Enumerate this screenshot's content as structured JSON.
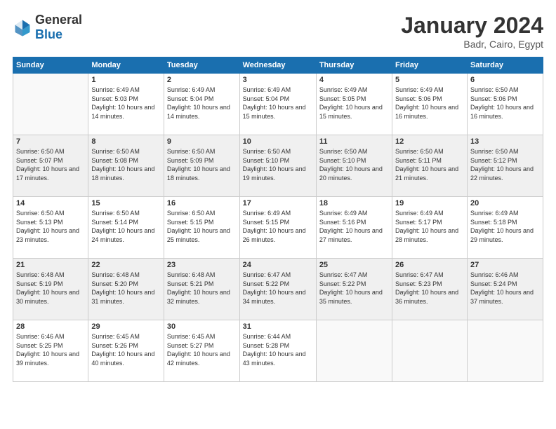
{
  "header": {
    "logo_general": "General",
    "logo_blue": "Blue",
    "title": "January 2024",
    "location": "Badr, Cairo, Egypt"
  },
  "days_of_week": [
    "Sunday",
    "Monday",
    "Tuesday",
    "Wednesday",
    "Thursday",
    "Friday",
    "Saturday"
  ],
  "weeks": [
    [
      {
        "day": "",
        "sunrise": "",
        "sunset": "",
        "daylight": ""
      },
      {
        "day": "1",
        "sunrise": "Sunrise: 6:49 AM",
        "sunset": "Sunset: 5:03 PM",
        "daylight": "Daylight: 10 hours and 14 minutes."
      },
      {
        "day": "2",
        "sunrise": "Sunrise: 6:49 AM",
        "sunset": "Sunset: 5:04 PM",
        "daylight": "Daylight: 10 hours and 14 minutes."
      },
      {
        "day": "3",
        "sunrise": "Sunrise: 6:49 AM",
        "sunset": "Sunset: 5:04 PM",
        "daylight": "Daylight: 10 hours and 15 minutes."
      },
      {
        "day": "4",
        "sunrise": "Sunrise: 6:49 AM",
        "sunset": "Sunset: 5:05 PM",
        "daylight": "Daylight: 10 hours and 15 minutes."
      },
      {
        "day": "5",
        "sunrise": "Sunrise: 6:49 AM",
        "sunset": "Sunset: 5:06 PM",
        "daylight": "Daylight: 10 hours and 16 minutes."
      },
      {
        "day": "6",
        "sunrise": "Sunrise: 6:50 AM",
        "sunset": "Sunset: 5:06 PM",
        "daylight": "Daylight: 10 hours and 16 minutes."
      }
    ],
    [
      {
        "day": "7",
        "sunrise": "Sunrise: 6:50 AM",
        "sunset": "Sunset: 5:07 PM",
        "daylight": "Daylight: 10 hours and 17 minutes."
      },
      {
        "day": "8",
        "sunrise": "Sunrise: 6:50 AM",
        "sunset": "Sunset: 5:08 PM",
        "daylight": "Daylight: 10 hours and 18 minutes."
      },
      {
        "day": "9",
        "sunrise": "Sunrise: 6:50 AM",
        "sunset": "Sunset: 5:09 PM",
        "daylight": "Daylight: 10 hours and 18 minutes."
      },
      {
        "day": "10",
        "sunrise": "Sunrise: 6:50 AM",
        "sunset": "Sunset: 5:10 PM",
        "daylight": "Daylight: 10 hours and 19 minutes."
      },
      {
        "day": "11",
        "sunrise": "Sunrise: 6:50 AM",
        "sunset": "Sunset: 5:10 PM",
        "daylight": "Daylight: 10 hours and 20 minutes."
      },
      {
        "day": "12",
        "sunrise": "Sunrise: 6:50 AM",
        "sunset": "Sunset: 5:11 PM",
        "daylight": "Daylight: 10 hours and 21 minutes."
      },
      {
        "day": "13",
        "sunrise": "Sunrise: 6:50 AM",
        "sunset": "Sunset: 5:12 PM",
        "daylight": "Daylight: 10 hours and 22 minutes."
      }
    ],
    [
      {
        "day": "14",
        "sunrise": "Sunrise: 6:50 AM",
        "sunset": "Sunset: 5:13 PM",
        "daylight": "Daylight: 10 hours and 23 minutes."
      },
      {
        "day": "15",
        "sunrise": "Sunrise: 6:50 AM",
        "sunset": "Sunset: 5:14 PM",
        "daylight": "Daylight: 10 hours and 24 minutes."
      },
      {
        "day": "16",
        "sunrise": "Sunrise: 6:50 AM",
        "sunset": "Sunset: 5:15 PM",
        "daylight": "Daylight: 10 hours and 25 minutes."
      },
      {
        "day": "17",
        "sunrise": "Sunrise: 6:49 AM",
        "sunset": "Sunset: 5:15 PM",
        "daylight": "Daylight: 10 hours and 26 minutes."
      },
      {
        "day": "18",
        "sunrise": "Sunrise: 6:49 AM",
        "sunset": "Sunset: 5:16 PM",
        "daylight": "Daylight: 10 hours and 27 minutes."
      },
      {
        "day": "19",
        "sunrise": "Sunrise: 6:49 AM",
        "sunset": "Sunset: 5:17 PM",
        "daylight": "Daylight: 10 hours and 28 minutes."
      },
      {
        "day": "20",
        "sunrise": "Sunrise: 6:49 AM",
        "sunset": "Sunset: 5:18 PM",
        "daylight": "Daylight: 10 hours and 29 minutes."
      }
    ],
    [
      {
        "day": "21",
        "sunrise": "Sunrise: 6:48 AM",
        "sunset": "Sunset: 5:19 PM",
        "daylight": "Daylight: 10 hours and 30 minutes."
      },
      {
        "day": "22",
        "sunrise": "Sunrise: 6:48 AM",
        "sunset": "Sunset: 5:20 PM",
        "daylight": "Daylight: 10 hours and 31 minutes."
      },
      {
        "day": "23",
        "sunrise": "Sunrise: 6:48 AM",
        "sunset": "Sunset: 5:21 PM",
        "daylight": "Daylight: 10 hours and 32 minutes."
      },
      {
        "day": "24",
        "sunrise": "Sunrise: 6:47 AM",
        "sunset": "Sunset: 5:22 PM",
        "daylight": "Daylight: 10 hours and 34 minutes."
      },
      {
        "day": "25",
        "sunrise": "Sunrise: 6:47 AM",
        "sunset": "Sunset: 5:22 PM",
        "daylight": "Daylight: 10 hours and 35 minutes."
      },
      {
        "day": "26",
        "sunrise": "Sunrise: 6:47 AM",
        "sunset": "Sunset: 5:23 PM",
        "daylight": "Daylight: 10 hours and 36 minutes."
      },
      {
        "day": "27",
        "sunrise": "Sunrise: 6:46 AM",
        "sunset": "Sunset: 5:24 PM",
        "daylight": "Daylight: 10 hours and 37 minutes."
      }
    ],
    [
      {
        "day": "28",
        "sunrise": "Sunrise: 6:46 AM",
        "sunset": "Sunset: 5:25 PM",
        "daylight": "Daylight: 10 hours and 39 minutes."
      },
      {
        "day": "29",
        "sunrise": "Sunrise: 6:45 AM",
        "sunset": "Sunset: 5:26 PM",
        "daylight": "Daylight: 10 hours and 40 minutes."
      },
      {
        "day": "30",
        "sunrise": "Sunrise: 6:45 AM",
        "sunset": "Sunset: 5:27 PM",
        "daylight": "Daylight: 10 hours and 42 minutes."
      },
      {
        "day": "31",
        "sunrise": "Sunrise: 6:44 AM",
        "sunset": "Sunset: 5:28 PM",
        "daylight": "Daylight: 10 hours and 43 minutes."
      },
      {
        "day": "",
        "sunrise": "",
        "sunset": "",
        "daylight": ""
      },
      {
        "day": "",
        "sunrise": "",
        "sunset": "",
        "daylight": ""
      },
      {
        "day": "",
        "sunrise": "",
        "sunset": "",
        "daylight": ""
      }
    ]
  ]
}
